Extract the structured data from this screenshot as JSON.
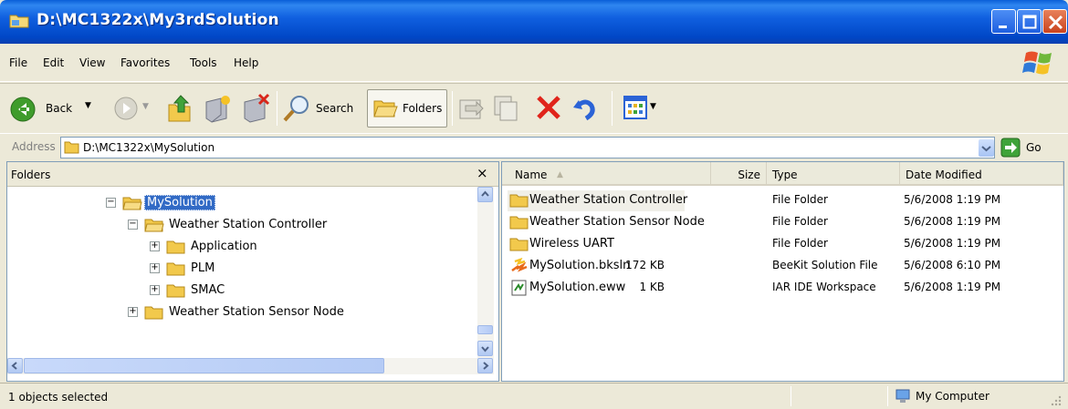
{
  "window": {
    "title": "D:\\MC1322x\\My3rdSolution"
  },
  "menu": [
    "File",
    "Edit",
    "View",
    "Favorites",
    "Tools",
    "Help"
  ],
  "toolbar": {
    "back_label": "Back",
    "search_label": "Search",
    "folders_label": "Folders"
  },
  "address": {
    "label": "Address",
    "value": "D:\\MC1322x\\MySolution",
    "go_label": "Go"
  },
  "folders_pane": {
    "title": "Folders",
    "close_glyph": "×",
    "tree": [
      {
        "label": "MySolution",
        "expander": "−",
        "selected": true
      },
      {
        "label": "Weather Station Controller",
        "expander": "−"
      },
      {
        "label": "Application",
        "expander": "+"
      },
      {
        "label": "PLM",
        "expander": "+"
      },
      {
        "label": "SMAC",
        "expander": "+"
      },
      {
        "label": "Weather Station Sensor Node",
        "expander": "+"
      }
    ]
  },
  "file_list": {
    "columns": {
      "name": "Name",
      "size": "Size",
      "type": "Type",
      "date": "Date Modified"
    },
    "rows": [
      {
        "name": "Weather Station Controller",
        "size": "",
        "type": "File Folder",
        "date": "5/6/2008 1:19 PM",
        "icon": "folder-icon"
      },
      {
        "name": "Weather Station Sensor Node",
        "size": "",
        "type": "File Folder",
        "date": "5/6/2008 1:19 PM",
        "icon": "folder-icon"
      },
      {
        "name": "Wireless UART",
        "size": "",
        "type": "File Folder",
        "date": "5/6/2008 1:19 PM",
        "icon": "folder-icon"
      },
      {
        "name": "MySolution.bksln",
        "size": "172 KB",
        "type": "BeeKit Solution File",
        "date": "5/6/2008 6:10 PM",
        "icon": "beekit-file-icon"
      },
      {
        "name": "MySolution.eww",
        "size": "1 KB",
        "type": "IAR IDE Workspace",
        "date": "5/6/2008 1:19 PM",
        "icon": "workspace-file-icon"
      }
    ]
  },
  "status": {
    "selection": "1 objects selected",
    "zone": "My Computer"
  },
  "colors": {
    "titlebar": "#0047c6",
    "selection": "#316ac5",
    "chrome": "#ece9d8"
  }
}
